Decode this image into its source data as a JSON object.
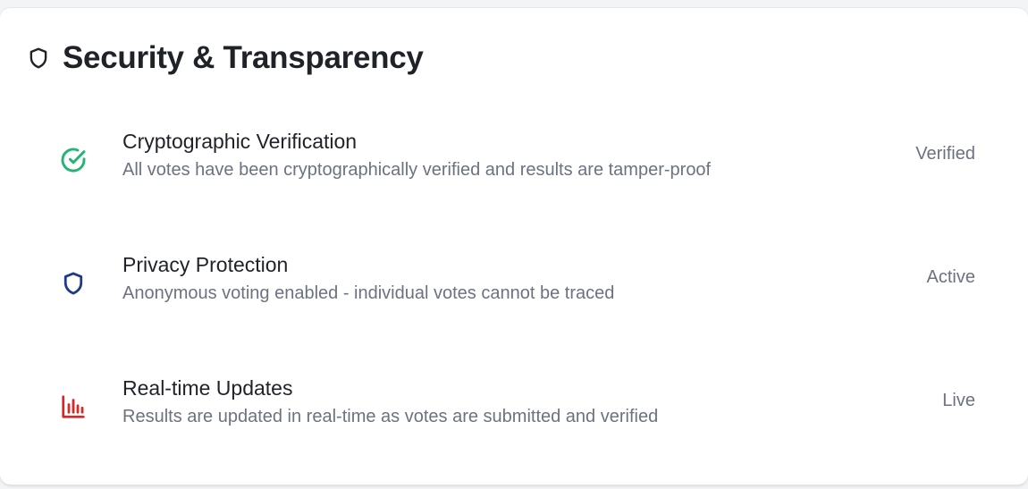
{
  "section": {
    "title": "Security & Transparency",
    "icon": "shield-icon"
  },
  "items": [
    {
      "name": "Cryptographic Verification",
      "description": "All votes have been cryptographically verified and results are tamper-proof",
      "status": "Verified",
      "icon": "check-circle-icon",
      "icon_color": "#22b573"
    },
    {
      "name": "Privacy Protection",
      "description": "Anonymous voting enabled - individual votes cannot be traced",
      "status": "Active",
      "icon": "shield-icon",
      "icon_color": "#1e3a8a"
    },
    {
      "name": "Real-time Updates",
      "description": "Results are updated in real-time as votes are submitted and verified",
      "status": "Live",
      "icon": "bar-chart-icon",
      "icon_color": "#dc2626"
    }
  ]
}
